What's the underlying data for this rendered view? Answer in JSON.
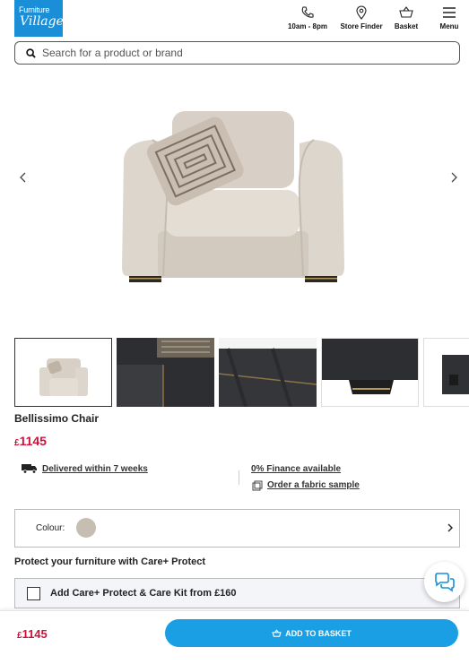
{
  "brand": {
    "line1": "Furniture",
    "line2": "Village",
    "color": "#1a8fd8"
  },
  "nav": {
    "hours": {
      "icon": "phone-icon",
      "label": "10am - 8pm"
    },
    "store": {
      "icon": "location-pin-icon",
      "label": "Store Finder"
    },
    "basket": {
      "icon": "basket-icon",
      "label": "Basket"
    },
    "menu": {
      "icon": "hamburger-icon",
      "label": "Menu"
    }
  },
  "search": {
    "placeholder": "Search for a product or brand",
    "value": ""
  },
  "product": {
    "title": "Bellissimo Chair",
    "currency": "£",
    "price": "1145",
    "price_color": "#d0103a"
  },
  "info": {
    "delivery": "Delivered within 7 weeks",
    "finance": "0% Finance available",
    "sample": "Order a fabric sample"
  },
  "colour": {
    "label": "Colour:",
    "swatch": "#c6bdb3"
  },
  "care": {
    "heading": "Protect your furniture with Care+ Protect",
    "checkbox_label": "Add Care+ Protect & Care Kit from £160",
    "checked": false
  },
  "sticky": {
    "currency": "£",
    "price": "1145",
    "button": "ADD TO BASKET",
    "button_color": "#1a9ee4"
  }
}
